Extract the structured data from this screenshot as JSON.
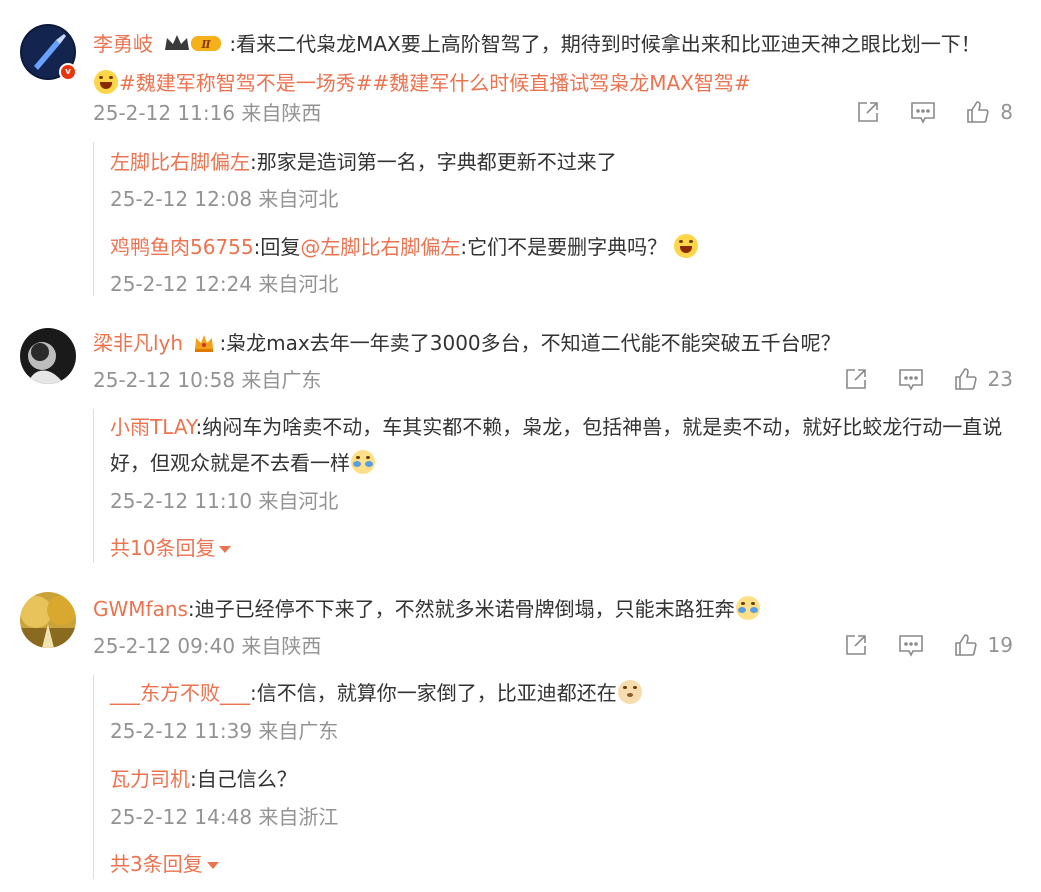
{
  "comments": [
    {
      "user": "李勇岐",
      "level": "Ⅱ",
      "text": ":看来二代枭龙MAX要上高阶智驾了，期待到时候拿出来和比亚迪天神之眼比划一下！",
      "topics": "#魏建军称智驾不是一场秀##魏建军什么时候直播试驾枭龙MAX智驾#",
      "meta": "25-2-12 11:16 来自陕西",
      "likes": "8",
      "replies": [
        {
          "user": "左脚比右脚偏左",
          "text": ":那家是造词第一名，字典都更新不过来了",
          "meta": "25-2-12 12:08 来自河北"
        },
        {
          "user": "鸡鸭鱼肉56755",
          "pre": ":回复",
          "mention": "@左脚比右脚偏左",
          "text": ":它们不是要删字典吗？",
          "meta": "25-2-12 12:24 来自河北"
        }
      ]
    },
    {
      "user": "梁非凡lyh",
      "text": ":枭龙max去年一年卖了3000多台，不知道二代能不能突破五千台呢？",
      "meta": "25-2-12 10:58 来自广东",
      "likes": "23",
      "replies": [
        {
          "user": "小雨TLAY",
          "text": ":纳闷车为啥卖不动，车其实都不赖，枭龙，包括神兽，就是卖不动，就好比蛟龙行动一直说好，但观众就是不去看一样",
          "meta": "25-2-12 11:10 来自河北"
        }
      ],
      "more": "共10条回复"
    },
    {
      "user": "GWMfans",
      "text": ":迪子已经停不下来了，不然就多米诺骨牌倒塌，只能末路狂奔",
      "meta": "25-2-12 09:40 来自陕西",
      "likes": "19",
      "replies": [
        {
          "user": "___东方不败___",
          "text": ":信不信，就算你一家倒了，比亚迪都还在",
          "meta": "25-2-12 11:39 来自广东"
        },
        {
          "user": "瓦力司机",
          "text": ":自己信么？",
          "meta": "25-2-12 14:48 来自浙江"
        }
      ],
      "more": "共3条回复"
    }
  ]
}
